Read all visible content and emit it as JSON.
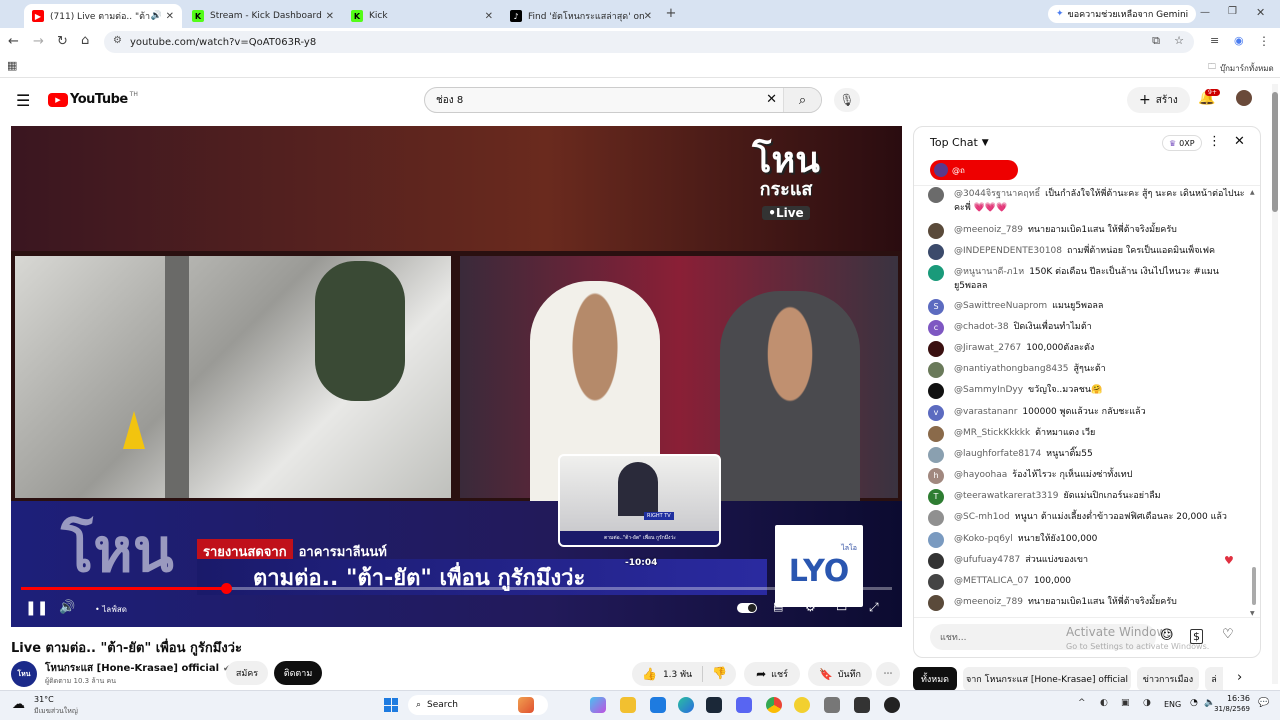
{
  "browser": {
    "tabs": [
      {
        "label": "(711) Live ตามต่อ.. \"ต้า-ยัต\" เ",
        "active": true
      },
      {
        "label": "Stream - Kick Dashboard",
        "active": false
      },
      {
        "label": "Kick",
        "active": false
      },
      {
        "label": "Find 'ยัตโหนกระแสล่าสุด' on TikTok",
        "active": false
      }
    ],
    "gemini_label": "ขอความช่วยเหลือจาก Gemini",
    "url": "youtube.com/watch?v=QoAT063R-y8",
    "bookmarks_label": "บุ๊กมาร์กทั้งหมด"
  },
  "youtube": {
    "logo": "YouTube",
    "logo_region": "TH",
    "search_value": "ช่อง 8",
    "create_label": "สร้าง",
    "notif_count": "9+",
    "colors": {
      "brand": "#ff0000",
      "live": "#ff0000"
    }
  },
  "player": {
    "overlay_brand_top": "โหน",
    "overlay_brand_bottom": "กระแส",
    "overlay_live": "•Live",
    "lower_third_small": "รายงานสดจาก",
    "lower_third_place": "อาคารมาลีนนท์",
    "lower_third_headline": "ตามต่อ.. \"ต้า-ยัต\" เพื่อน กูรักมึงว่ะ",
    "sponsor_logo": "LYO",
    "sponsor_brand": "ไลโอ",
    "preview_time": "-10:04",
    "live_label": "• ไลฟ์สด",
    "progress": 0.235,
    "thumb_label": "RIGHT TV",
    "thumb_caption": "ตามต่อ..\"ต้า-ยัต\" เพื่อน กูรักมึงว่ะ"
  },
  "video": {
    "title": "Live ตามต่อ.. \"ต้า-ยัต\" เพื่อน กูรักมึงว่ะ",
    "channel": "โหนกระแส [Hone-Krasae] official",
    "subscribers": "ผู้ติดตาม 10.3 ล้าน คน",
    "join_label": "สมัคร",
    "subscribed_label": "ติดตาม",
    "like_count": "1.3 พัน",
    "share_label": "แชร์",
    "save_label": "บันทึก"
  },
  "chat": {
    "header": "Top Chat",
    "xp": "0XP",
    "pinned_user": "@ถ",
    "messages": [
      {
        "author": "@3044จิรฐานาคฤทธิ์",
        "text": "เป็นกำลังใจให้พี่ต้านะคะ สู้ๆ นะคะ เดินหน้าต่อไปนะคะพี่ 💗💗💗",
        "color": "#6b6b6b"
      },
      {
        "author": "@meenoiz_789",
        "text": "ทนายอามเบิด1แสน ให้พี่ต้าจริงมั้ยครับ",
        "color": "#5a4a3a"
      },
      {
        "author": "@INDEPENDENTE30108",
        "text": "ถามพี่ต้าหน่อย ใครเป็นแอดมินเพ็จเฟค",
        "color": "#3b4a6b"
      },
      {
        "author": "@หนูนานาดี-ภ1ห",
        "text": "150K ต่อเดือน ปีละเป็นล้าน เงินไปไหนวะ #แมนยู5พอลล",
        "color": "#1a9a7a"
      },
      {
        "author": "@SawittreeNuaprom",
        "text": "แมนยู5พอลล",
        "color": "#5c6bc0",
        "initial": "S"
      },
      {
        "author": "@chadot-38",
        "text": "ปิดเงินเพื่อนทำไมต้า",
        "color": "#7e57c2",
        "initial": "c"
      },
      {
        "author": "@Jirawat_2767",
        "text": "100,000ตังละตัง",
        "color": "#3a1010"
      },
      {
        "author": "@nantiyathongbang8435",
        "text": "สู้ๆนะต้า",
        "color": "#6a7a5a"
      },
      {
        "author": "@SammyInDyy",
        "text": "ขวัญใจ..มวลชน🤗",
        "color": "#111111"
      },
      {
        "author": "@varastananr",
        "text": "100000 พูดแล้วนะ กลับชะแล้ว",
        "color": "#5c6bc0",
        "initial": "v"
      },
      {
        "author": "@MR_StickKkkkk",
        "text": "ต้าหมาแดง เวีย",
        "color": "#8a6a4a"
      },
      {
        "author": "@laughforfate8174",
        "text": "หนูนาติ๊ม55",
        "color": "#8aa0b0"
      },
      {
        "author": "@hayoohaa",
        "text": "ร้องไห้ไรวะ กุเห็นแม่งซ่าทั้งเทป",
        "color": "#a1887f",
        "initial": "h"
      },
      {
        "author": "@teerawatkarerat3319",
        "text": "ยัดแม่นปิกเกอร์นะอย่าลืม",
        "color": "#2e7d32",
        "initial": "T"
      },
      {
        "author": "@SC-mh1od",
        "text": "หนูนา ต้าแม่งเลี้ยงต่ำข้าวออฟฟิศเดือนละ 20,000 แล้ว",
        "color": "#909090"
      },
      {
        "author": "@Koko-pq6yl",
        "text": "หนายให้ยัง100,000",
        "color": "#7a9ac0"
      },
      {
        "author": "@ufufuay4787",
        "text": "ส่วนแบ่งของเขา",
        "color": "#333333"
      },
      {
        "author": "@METTALICA_07",
        "text": "100,000",
        "color": "#444444"
      },
      {
        "author": "@meenoiz_789",
        "text": "ทนายอามเบิด1แสน ให้พี่ต้าจริงมั้ยครับ",
        "color": "#5a4a3a"
      }
    ],
    "input_placeholder": "แชท...",
    "watermark_title": "Activate Windows",
    "watermark_sub": "Go to Settings to activate Windows.",
    "filters": [
      "ทั้งหมด",
      "จาก โหนกระแส [Hone-Krasae] official",
      "ข่าวการเมือง",
      "ล่"
    ]
  },
  "taskbar": {
    "temp": "31°C",
    "weather": "มีเมฆส่วนใหญ่",
    "search_label": "Search",
    "lang": "ENG",
    "time": "16:36",
    "date": "31/8/2569"
  }
}
